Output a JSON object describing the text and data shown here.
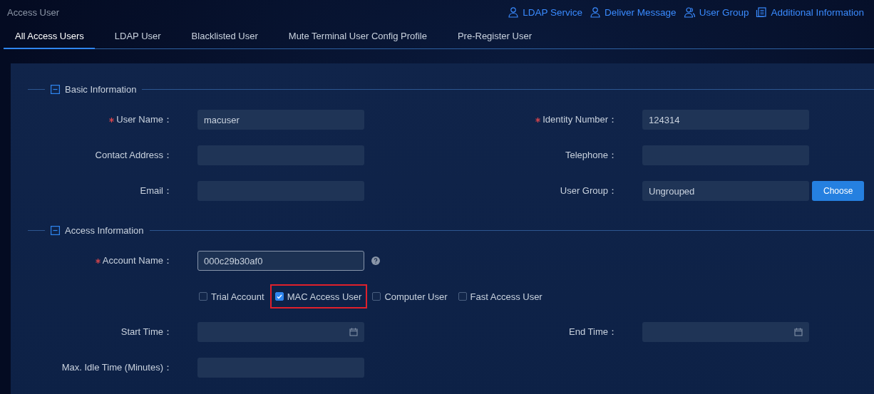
{
  "header": {
    "title": "Access User",
    "links": [
      {
        "label": "LDAP Service",
        "kind": "user"
      },
      {
        "label": "Deliver Message",
        "kind": "user"
      },
      {
        "label": "User Group",
        "kind": "users"
      },
      {
        "label": "Additional Information",
        "kind": "document"
      }
    ]
  },
  "tabs": [
    {
      "label": "All Access Users",
      "selected": true
    },
    {
      "label": "LDAP User",
      "selected": false
    },
    {
      "label": "Blacklisted User",
      "selected": false
    },
    {
      "label": "Mute Terminal User Config Profile",
      "selected": false
    },
    {
      "label": "Pre-Register User",
      "selected": false
    }
  ],
  "sections": [
    {
      "title": "Basic Information",
      "expanded": true,
      "rows": [
        {
          "kind": "pair",
          "fields": [
            {
              "label": "User Name：",
              "required": true,
              "value": "macuser"
            },
            {
              "label": "Identity Number：",
              "required": true,
              "value": "124314"
            }
          ]
        },
        {
          "kind": "pair",
          "fields": [
            {
              "label": "Contact Address：",
              "required": false
            },
            {
              "label": "Telephone：",
              "required": false
            }
          ]
        },
        {
          "kind": "pair",
          "fields": [
            {
              "label": "Email：",
              "required": false
            },
            {
              "label": "User Group：",
              "required": false,
              "value": "Ungrouped",
              "button": "Choose"
            }
          ]
        }
      ]
    },
    {
      "title": "Access Information",
      "expanded": true,
      "rows": [
        {
          "kind": "pair",
          "fields": [
            {
              "label": "Account Name：",
              "required": true,
              "value": "000c29b30af0",
              "focused": true,
              "help": true
            }
          ]
        },
        {
          "kind": "checks",
          "options": [
            {
              "label": "Trial Account",
              "checked": false,
              "highlighted": false
            },
            {
              "label": "MAC Access User",
              "checked": true,
              "highlighted": true
            },
            {
              "label": "Computer User",
              "checked": false,
              "highlighted": false
            },
            {
              "label": "Fast Access User",
              "checked": false,
              "highlighted": false
            }
          ]
        },
        {
          "kind": "pair",
          "fields": [
            {
              "label": "Start Time：",
              "required": false,
              "date": true
            },
            {
              "label": "End Time：",
              "required": false,
              "date": true
            }
          ]
        },
        {
          "kind": "pair",
          "fields": [
            {
              "label": "Max. Idle Time (Minutes)：",
              "required": false
            }
          ]
        }
      ]
    }
  ]
}
